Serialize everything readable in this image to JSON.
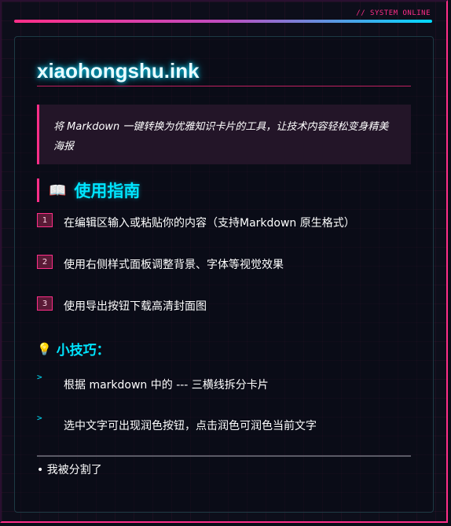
{
  "status_text": "// SYSTEM ONLINE",
  "title": "xiaohongshu.ink",
  "intro": "将 Markdown 一键转换为优雅知识卡片的工具，让技术内容轻松变身精美海报",
  "guide": {
    "icon": "book-icon",
    "heading": "使用指南",
    "steps": [
      {
        "num": "1",
        "text": "在编辑区输入或粘贴你的内容（支持Markdown 原生格式）"
      },
      {
        "num": "2",
        "text": "使用右侧样式面板调整背景、字体等视觉效果"
      },
      {
        "num": "3",
        "text": "使用导出按钮下载高清封面图"
      }
    ]
  },
  "tips": {
    "icon": "lightbulb-icon",
    "heading": "小技巧：",
    "items": [
      "根据 markdown 中的 --- 三横线拆分卡片",
      "选中文字可出现润色按钮，点击润色可润色当前文字"
    ]
  },
  "footer_bullet": "• 我被分割了",
  "colors": {
    "accent_pink": "#ff2e88",
    "accent_cyan": "#00e5ff",
    "background": "#0d0e1a"
  }
}
